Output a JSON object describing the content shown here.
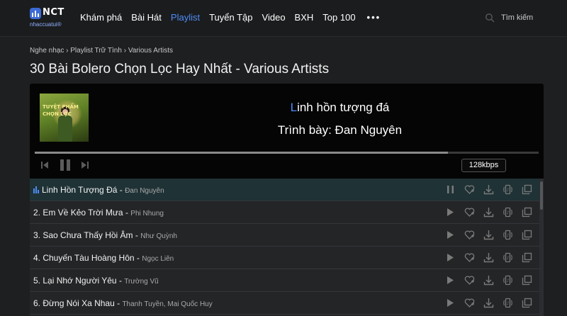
{
  "header": {
    "logo_text": "NCT",
    "logo_sub": "nhaccuatui®",
    "nav": [
      "Khám phá",
      "Bài Hát",
      "Playlist",
      "Tuyển Tập",
      "Video",
      "BXH",
      "Top 100"
    ],
    "active_nav": "Playlist",
    "more": "•••",
    "search_placeholder": "Tìm kiếm"
  },
  "breadcrumb": [
    "Nghe nhạc",
    "Playlist Trữ Tình",
    "Various Artists"
  ],
  "page_title": "30 Bài Bolero Chọn Lọc Hay Nhất - Various Artists",
  "player": {
    "cover_text": "TUYỆT PHẨM CHỌN LỌC",
    "title_first": "L",
    "title_rest": "inh hồn tượng đá",
    "artist_line": "Trình bày: Đan Nguyên",
    "progress": 0.82,
    "bitrate": "128kbps"
  },
  "tracks": [
    {
      "name": "Linh Hồn Tượng Đá",
      "sep": " - ",
      "artist": "Đan Nguyên",
      "playing": true
    },
    {
      "name": "2. Em Về Kẻo Trời Mưa",
      "sep": " - ",
      "artist": "Phi Nhung"
    },
    {
      "name": "3. Sao Chưa Thấy Hồi Âm",
      "sep": " - ",
      "artist": "Như Quỳnh"
    },
    {
      "name": "4.  Chuyến Tàu Hoàng Hôn",
      "sep": " - ",
      "artist": "Ngọc Liên"
    },
    {
      "name": "5. Lại Nhớ Người Yêu",
      "sep": " - ",
      "artist": "Trường Vũ"
    },
    {
      "name": "6. Đừng Nói Xa Nhau",
      "sep": " - ",
      "artist": "Thanh Tuyền, Mai Quốc Huy"
    }
  ],
  "colors": {
    "accent": "#4c8cf5",
    "background": "#1e1f21",
    "player_bg": "#050505",
    "active_row": "#1f3236"
  }
}
